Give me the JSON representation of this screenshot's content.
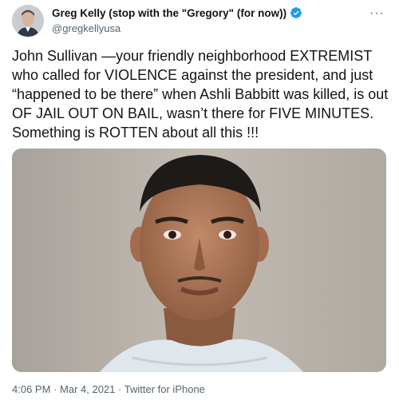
{
  "author": {
    "display_name": "Greg Kelly (stop with the \"Gregory\" (for now))",
    "handle": "@gregkellyusa",
    "verified": true
  },
  "tweet": {
    "text": "John Sullivan —your friendly neighborhood EXTREMIST who called for VIOLENCE against the president, and just “happened to be there” when Ashli Babbitt was killed, is out OF JAIL OUT ON BAIL, wasn’t there for FIVE MINUTES.  Something is ROTTEN about all this !!!"
  },
  "meta": {
    "time": "4:06 PM",
    "separator": "·",
    "date": "Mar 4, 2021",
    "source": "Twitter for iPhone"
  },
  "icons": {
    "more": "more-options-icon",
    "verified": "verified-badge-icon"
  },
  "colors": {
    "text": "#0f1419",
    "secondary": "#536471",
    "verified_blue": "#1d9bf0"
  }
}
